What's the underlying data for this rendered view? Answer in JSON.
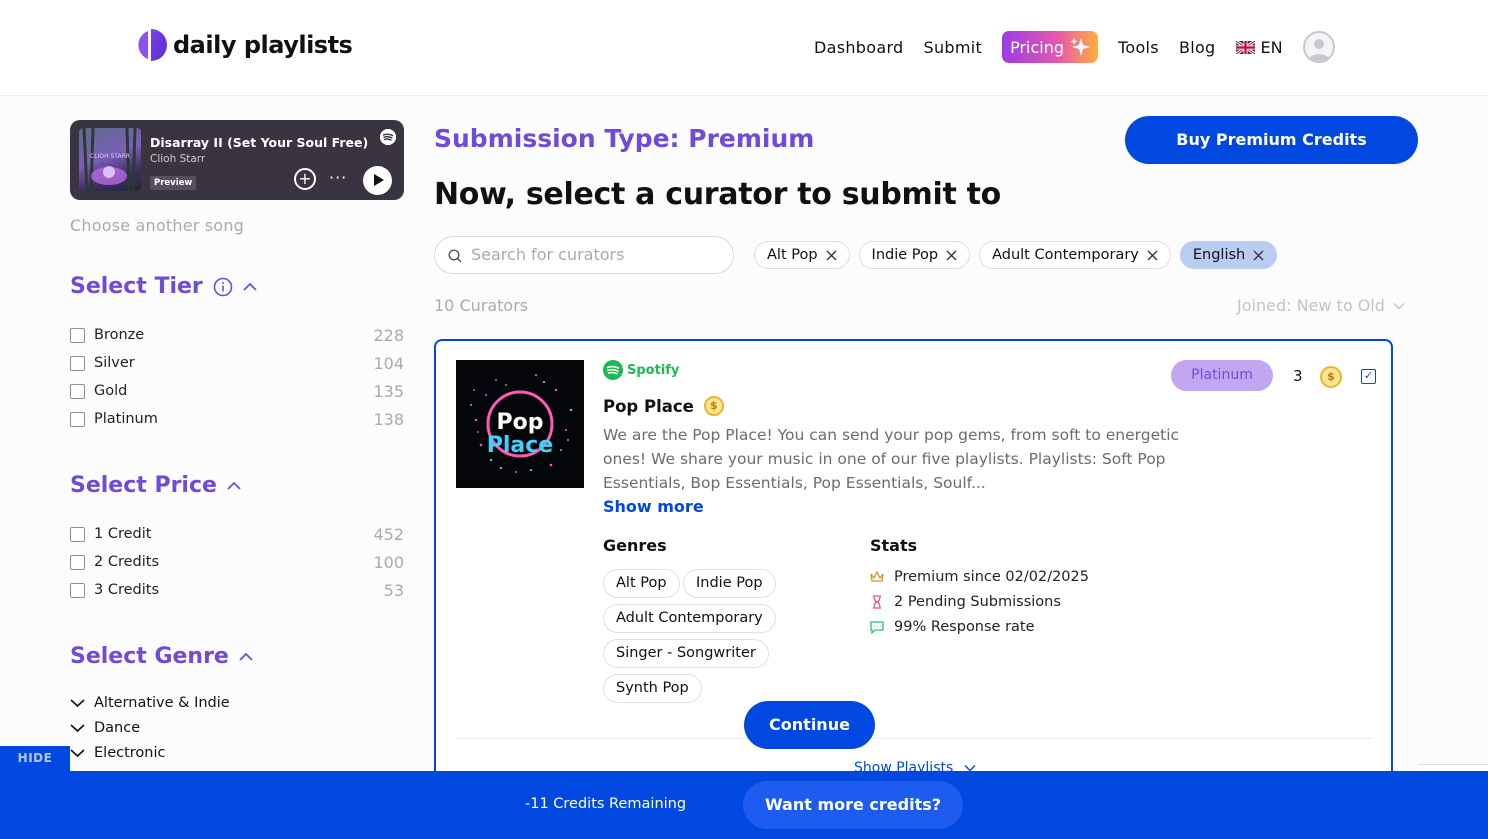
{
  "header": {
    "brand": "daily playlists",
    "nav": [
      "Dashboard",
      "Submit"
    ],
    "pricing_label": "Pricing",
    "tools_label": "Tools",
    "blog_label": "Blog",
    "lang_label": "EN"
  },
  "sidebar": {
    "track": {
      "title": "Disarray II (Set Your Soul Free)",
      "artist": "Clioh Starr",
      "preview_label": "Preview",
      "more_label": "···"
    },
    "choose_song": "Choose another song",
    "tier": {
      "title": "Select Tier",
      "items": [
        {
          "label": "Bronze",
          "count": "228"
        },
        {
          "label": "Silver",
          "count": "104"
        },
        {
          "label": "Gold",
          "count": "135"
        },
        {
          "label": "Platinum",
          "count": "138"
        }
      ]
    },
    "price": {
      "title": "Select Price",
      "items": [
        {
          "label": "1 Credit",
          "count": "452"
        },
        {
          "label": "2 Credits",
          "count": "100"
        },
        {
          "label": "3 Credits",
          "count": "53"
        }
      ]
    },
    "genre": {
      "title": "Select Genre",
      "items": [
        "Alternative & Indie",
        "Dance",
        "Electronic"
      ]
    },
    "hide_label": "HIDE"
  },
  "main": {
    "submission_type": "Submission Type: Premium",
    "buy_label": "Buy Premium Credits",
    "heading": "Now, select a curator to submit to",
    "search_placeholder": "Search for curators",
    "chips": [
      {
        "label": "Alt Pop",
        "active": false
      },
      {
        "label": "Indie Pop",
        "active": false
      },
      {
        "label": "Adult Contemporary",
        "active": false
      },
      {
        "label": "English",
        "active": true
      }
    ],
    "count_label": "10 Curators",
    "sort_label": "Joined: New to Old"
  },
  "curator": {
    "platform": "Spotify",
    "art_text_top": "Pop",
    "art_text_bottom": "Place",
    "name": "Pop Place",
    "description": "We are the Pop Place! You can send your pop gems, from soft to energetic ones! We share your music in one of our five playlists. Playlists: Soft Pop Essentials, Bop Essentials, Pop Essentials, Soulf...",
    "show_more": "Show more",
    "tier": "Platinum",
    "credits": "3",
    "genres_title": "Genres",
    "genres": [
      "Alt Pop",
      "Indie Pop",
      "Adult Contemporary",
      "Singer - Songwriter",
      "Synth Pop"
    ],
    "stats_title": "Stats",
    "stats": [
      "Premium since 02/02/2025",
      "2 Pending Submissions",
      "99% Response rate"
    ],
    "continue_label": "Continue",
    "show_playlists": "Show Playlists"
  },
  "footer": {
    "credits_remaining": "-11 Credits Remaining",
    "more_credits": "Want more credits?"
  },
  "colors": {
    "primary_blue": "#0048e0",
    "purple": "#6f4bd8",
    "spotify_green": "#1db954"
  }
}
